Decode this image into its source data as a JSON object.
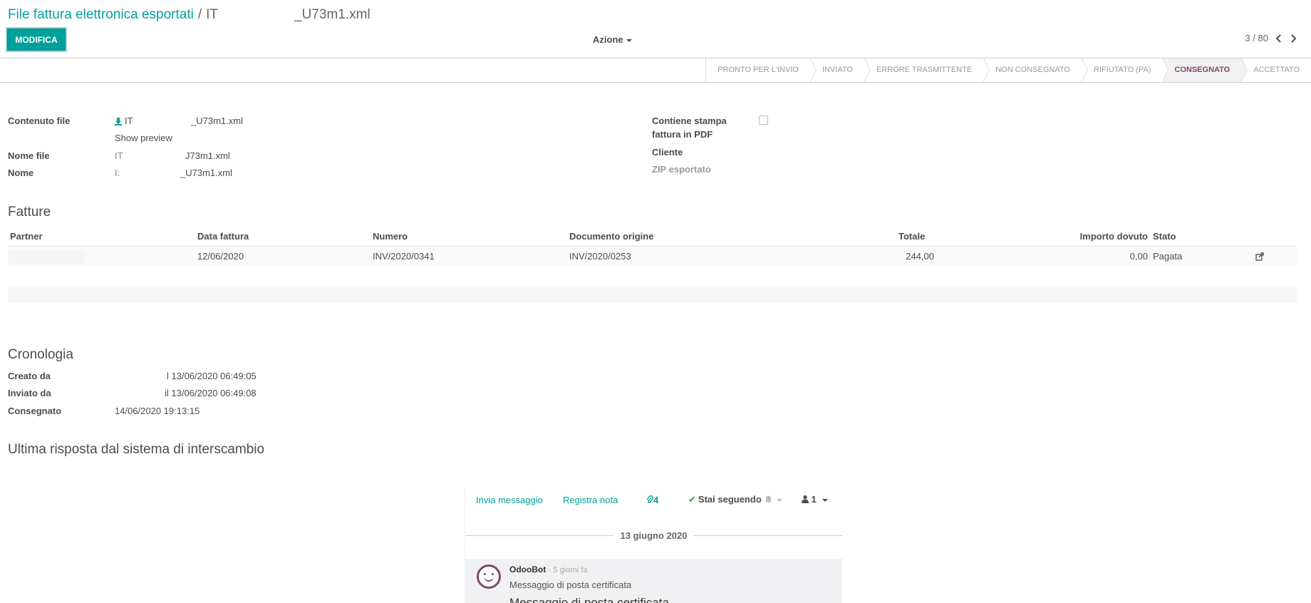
{
  "breadcrumb": {
    "parent": "File fattura elettronica esportati",
    "separator": "/",
    "current_prefix": "IT",
    "current_suffix": "_U73m1.xml"
  },
  "toolbar": {
    "edit_label": "MODIFICA",
    "action_label": "Azione",
    "pager": "3 / 80"
  },
  "statusbar": {
    "stages": [
      "PRONTO PER L'INVIO",
      "INVIATO",
      "ERRORE TRASMITTENTE",
      "NON CONSEGNATO",
      "RIFIUTATO (PA)",
      "CONSEGNATO",
      "ACCETTATO"
    ],
    "active": "CONSEGNATO"
  },
  "form": {
    "file_content_label": "Contenuto file",
    "file_content_prefix": "IT",
    "file_content_suffix": "_U73m1.xml",
    "show_preview": "Show preview",
    "filename_label": "Nome file",
    "filename_prefix": "IΤ",
    "filename_suffix": "J73m1.xml",
    "name_label": "Nome",
    "name_prefix": "I:",
    "name_suffix": "_U73m1.xml",
    "pdf_label_line1": "Contiene stampa",
    "pdf_label_line2": "fattura in PDF",
    "pdf_checked": false,
    "customer_label": "Cliente",
    "zip_label": "ZIP esportato"
  },
  "invoices": {
    "title": "Fatture",
    "columns": {
      "partner": "Partner",
      "date": "Data fattura",
      "number": "Numero",
      "origin": "Documento origine",
      "total": "Totale",
      "due": "Importo dovuto",
      "state": "Stato"
    },
    "rows": [
      {
        "date": "12/06/2020",
        "number": "INV/2020/0341",
        "origin": "INV/2020/0253",
        "total": "244,00",
        "due": "0,00",
        "state": "Pagata"
      }
    ]
  },
  "history": {
    "title": "Cronologia",
    "created_label": "Creato da",
    "created_value": "l 13/06/2020 06:49:05",
    "sent_label": "Inviato da",
    "sent_value": "il 13/06/2020 06:49:08",
    "delivered_label": "Consegnato",
    "delivered_value": "14/06/2020 19:13:15"
  },
  "last_response": {
    "title": "Ultima risposta dal sistema di interscambio"
  },
  "chatter": {
    "send_message": "Invia messaggio",
    "log_note": "Registra nota",
    "attachments": "4",
    "following": "Stai seguendo",
    "followers": "1",
    "date_separator": "13 giugno 2020",
    "message": {
      "author": "OdooBot",
      "time": "- 5 giorni fa",
      "subject": "Messaggio di posta certificata",
      "body": "Messaggio di posta certificata"
    }
  },
  "colors": {
    "primary": "#00a09d",
    "active_stage": "#7c4a6d",
    "check": "#28a745"
  }
}
